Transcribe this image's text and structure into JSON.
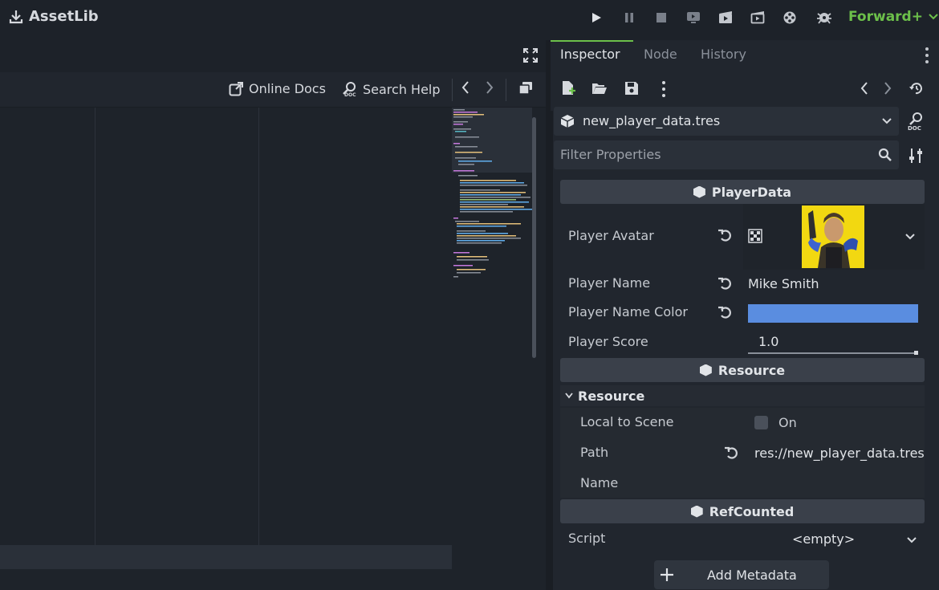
{
  "topbar": {
    "assetlib_label": "AssetLib",
    "renderer_label": "Forward+",
    "icons": [
      "play-icon",
      "pause-icon",
      "stop-icon",
      "remote-debug-icon",
      "play-scene-icon",
      "play-custom-scene-icon",
      "movie-maker-icon",
      "debug-icon"
    ]
  },
  "editor": {
    "online_docs_label": "Online Docs",
    "search_help_label": "Search Help"
  },
  "inspector": {
    "tabs": [
      "Inspector",
      "Node",
      "History"
    ],
    "resource_file": "new_player_data.tres",
    "filter_placeholder": "Filter Properties",
    "sections": {
      "player_data": "PlayerData",
      "resource": "Resource",
      "resource_group": "Resource",
      "refcounted": "RefCounted"
    },
    "props": {
      "player_avatar_label": "Player Avatar",
      "player_name_label": "Player Name",
      "player_name_value": "Mike Smith",
      "player_name_color_label": "Player Name Color",
      "player_name_color_value": "#5a8de0",
      "player_score_label": "Player Score",
      "player_score_value": "1.0",
      "local_to_scene_label": "Local to Scene",
      "local_to_scene_value": "On",
      "path_label": "Path",
      "path_value": "res://new_player_data.tres",
      "name_label": "Name",
      "name_value": "",
      "script_label": "Script",
      "script_value": "<empty>"
    },
    "add_metadata_label": "Add Metadata"
  },
  "colors": {
    "accent": "#6cc04a",
    "tab_underline": "#6cc04a",
    "background": "#1d2229"
  }
}
